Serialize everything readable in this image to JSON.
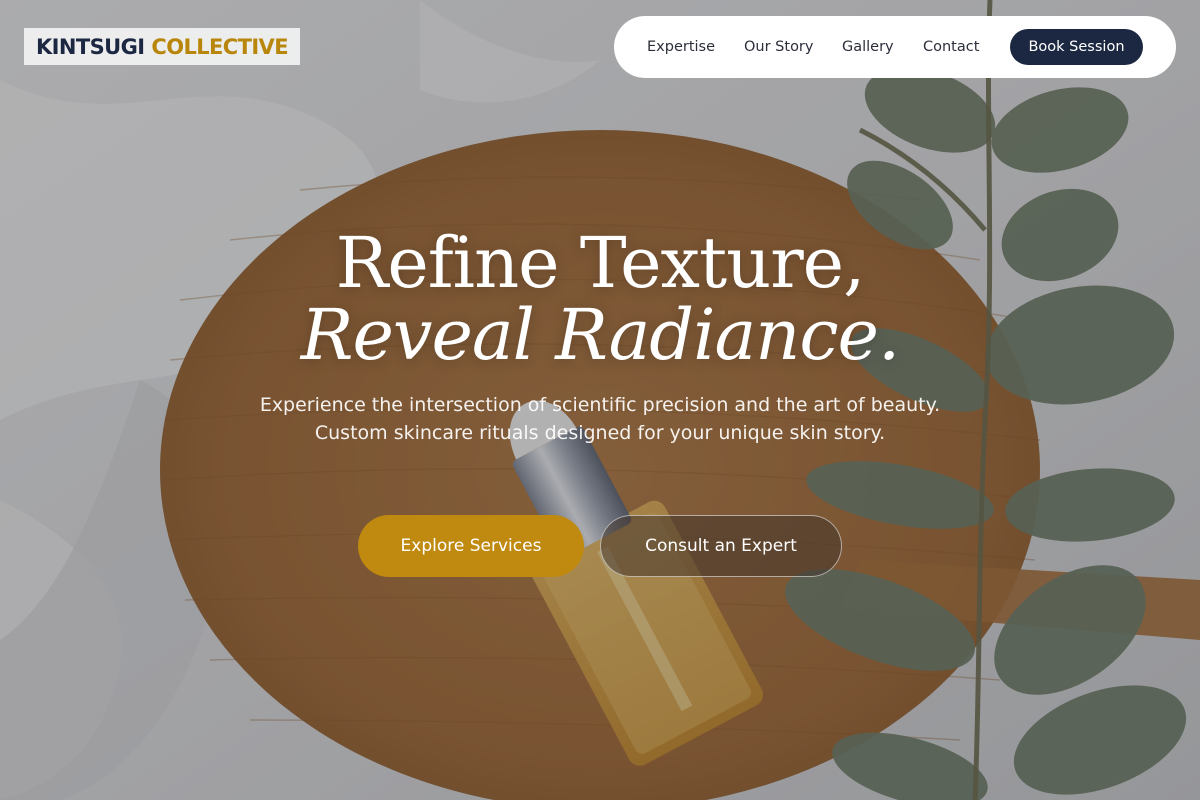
{
  "brand": {
    "name_part1": "KINTSUGI",
    "name_part2": "COLLECTIVE"
  },
  "nav": {
    "links": [
      "Expertise",
      "Our Story",
      "Gallery",
      "Contact"
    ],
    "cta": "Book Session"
  },
  "hero": {
    "headline_line1": "Refine Texture,",
    "headline_line2": "Reveal Radiance.",
    "subtitle": "Experience the intersection of scientific precision and the art of beauty. Custom skincare rituals designed for your unique skin story.",
    "primary_button": "Explore Services",
    "secondary_button": "Consult an Expert"
  },
  "colors": {
    "brand_navy": "#1c2741",
    "brand_gold": "#b8860b",
    "primary_button": "#c08a10"
  }
}
